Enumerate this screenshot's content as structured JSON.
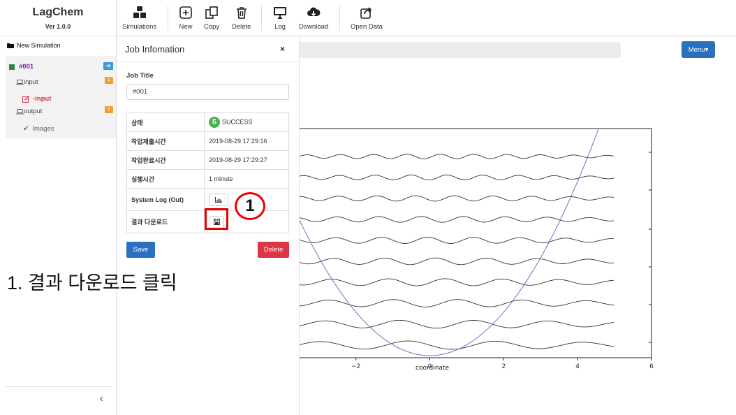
{
  "app": {
    "name": "LagChem",
    "version": "Ver 1.0.0"
  },
  "toolbar": {
    "simulations": "Simulations",
    "new": "New",
    "copy": "Copy",
    "delete": "Delete",
    "log": "Log",
    "download": "Download",
    "open_data": "Open Data"
  },
  "sidebar": {
    "new_simulation": "New Simulation",
    "job": {
      "label": "#001"
    },
    "input": {
      "label": "input",
      "count": "1"
    },
    "input_child": {
      "label": "-input"
    },
    "output": {
      "label": "output",
      "count": "1"
    },
    "images": {
      "label": "Images"
    }
  },
  "menu_button": "Menu▾",
  "panel": {
    "title": "Job Infomation",
    "close": "×",
    "job_title_label": "Job Title",
    "job_title_value": "#001",
    "rows": [
      {
        "key": "상태",
        "value": "SUCCESS",
        "badge": "S"
      },
      {
        "key": "작업제출시간",
        "value": "2019-08-29 17:29:16"
      },
      {
        "key": "작업완료시간",
        "value": "2019-08-29 17:29:27"
      },
      {
        "key": "실행시간",
        "value": "1 minute"
      },
      {
        "key": "System Log (Out)"
      },
      {
        "key": "결과 다운로드"
      }
    ],
    "save": "Save",
    "delete": "Delete"
  },
  "annotation": {
    "step_number": "1",
    "instruction": "1. 결과 다운로드 클릭"
  },
  "chart_data": {
    "type": "line",
    "xlabel": "coordinate",
    "x_ticks": [
      "−2",
      "0",
      "2",
      "4",
      "6"
    ],
    "xlim": [
      -3.6,
      6
    ],
    "series": [
      {
        "kind": "parabola",
        "formula": "V(x)=0.5*x^2",
        "color": "#7b68c8"
      }
    ],
    "wavefunction_levels": 10,
    "colors": {
      "curves": "#333333",
      "potential": "#7b68c8"
    }
  }
}
